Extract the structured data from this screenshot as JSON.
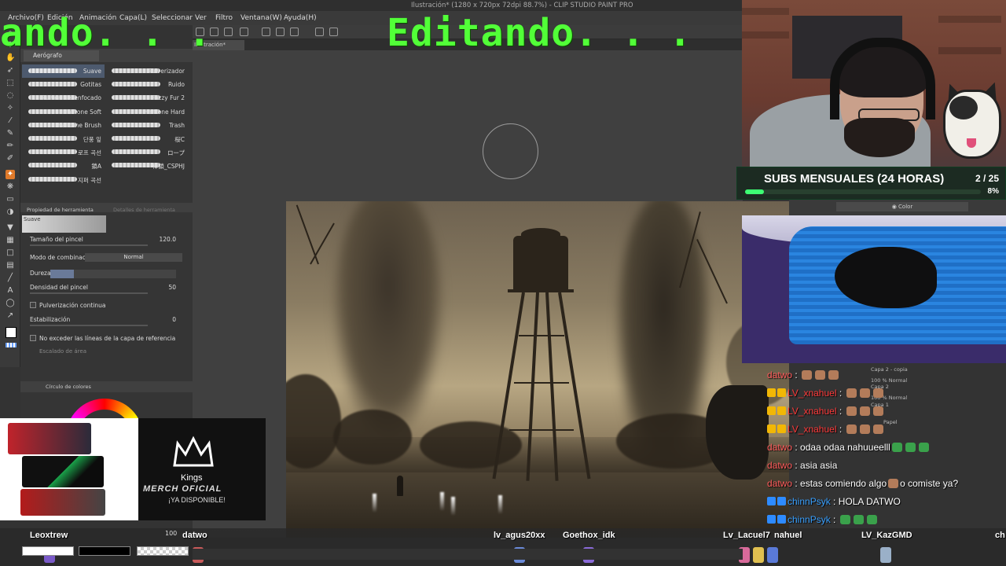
{
  "app": {
    "title": "Ilustración* (1280 x 720px 72dpi 88.7%) - CLIP STUDIO PAINT PRO",
    "menu": [
      "Archivo(F)",
      "Edición",
      "Animación",
      "Capa(L)",
      "Seleccionar",
      "Ver",
      "Filtro",
      "Ventana(W)",
      "Ayuda(H)"
    ],
    "document_tab": "Ilustración*"
  },
  "overlay": {
    "status_left": "ando. . .",
    "status_main": "Editando. . ."
  },
  "brush_panel": {
    "group": "Aerógrafo",
    "brushes": [
      {
        "name": "Suave",
        "selected": true
      },
      {
        "name": "Pulverizador"
      },
      {
        "name": "Gotitas"
      },
      {
        "name": "Ruido"
      },
      {
        "name": "Pulver. desenfocado"
      },
      {
        "name": "Fuzzy Fur 2"
      },
      {
        "name": "Halftone Soft"
      },
      {
        "name": "Halftone Hard"
      },
      {
        "name": "Halftone Brush"
      },
      {
        "name": "Trash"
      },
      {
        "name": "단풍 잎"
      },
      {
        "name": "桜C"
      },
      {
        "name": "로프 곡선"
      },
      {
        "name": "ロープ"
      },
      {
        "name": "鎖A"
      },
      {
        "name": "棒鎖_CSPHJ"
      },
      {
        "name": "지퍼 곡선"
      }
    ]
  },
  "tool_property": {
    "tab_label": "Propiedad de herramienta",
    "tab2_label": "Detalles de herramienta",
    "preview_label": "Suave",
    "brush_size_label": "Tamaño del pincel",
    "brush_size_value": "120.0",
    "blend_mode_label": "Modo de combinación",
    "blend_mode_value": "Normal",
    "hardness_label": "Dureza",
    "hardness_level": 0.19,
    "density_label": "Densidad del pincel",
    "density_value": "50",
    "continuous_spray_label": "Pulverización continua",
    "stabilization_label": "Estabilización",
    "stabilization_value": "0",
    "ref_layer_label": "No exceder las líneas de la capa de referencia",
    "area_scale_label": "Escalado de área"
  },
  "color_panel": {
    "tab_label": "Círculo de colores"
  },
  "subs_goal": {
    "title": "SUBS MENSUALES (24 HORAS)",
    "count": "2 / 25",
    "percent_label": "8%",
    "progress": 0.08
  },
  "layer_panel": {
    "color_mode": "Color",
    "layers": [
      {
        "name": "Capa 2 - copia",
        "info": "100 % Normal"
      },
      {
        "name": "Capa 2",
        "info": "100 % Normal"
      },
      {
        "name": "Capa 1",
        "info": ""
      },
      {
        "name": "Papel",
        "info": ""
      }
    ]
  },
  "chat": [
    {
      "user": "datwo",
      "badges": [],
      "user_color": "#ff5c5c",
      "msg": ""
    },
    {
      "user": "LV_xnahuel",
      "badges": [
        "gold",
        "gold"
      ],
      "user_color": "#ff3b3b",
      "msg": ""
    },
    {
      "user": "LV_xnahuel",
      "badges": [
        "gold",
        "gold"
      ],
      "user_color": "#ff3b3b",
      "msg": ""
    },
    {
      "user": "LV_xnahuel",
      "badges": [
        "gold",
        "gold"
      ],
      "user_color": "#ff3b3b",
      "msg": ""
    },
    {
      "user": "datwo",
      "badges": [],
      "user_color": "#ff5c5c",
      "msg": "odaa odaa nahuueelll"
    },
    {
      "user": "datwo",
      "badges": [],
      "user_color": "#ff5c5c",
      "msg": "asia asia"
    },
    {
      "user": "datwo",
      "badges": [],
      "user_color": "#ff5c5c",
      "msg": "estas comiendo algo",
      "msg2": "o comiste ya?"
    },
    {
      "user": "chinnPsyk",
      "badges": [
        "blue",
        "blue"
      ],
      "user_color": "#39a0ff",
      "msg": "HOLA DATWO"
    },
    {
      "user": "chinnPsyk",
      "badges": [
        "blue",
        "blue"
      ],
      "user_color": "#39a0ff",
      "msg": ""
    }
  ],
  "merch": {
    "brand": "Kings",
    "line1": "MERCH OFICIAL",
    "line2": "¡YA DISPONIBLE!"
  },
  "bottom_users": [
    "Leoxtrew",
    "datwo",
    "lv_agus20xx",
    "Goethox_idk",
    "Lv_Lacuel7",
    "nahuel",
    "LV_KazGMD",
    "ch"
  ],
  "status": {
    "zoom": "100"
  },
  "colors": {
    "accent_green": "#52ff38",
    "subs_fill": "#3dff73",
    "tool_active": "#e07a2a"
  }
}
